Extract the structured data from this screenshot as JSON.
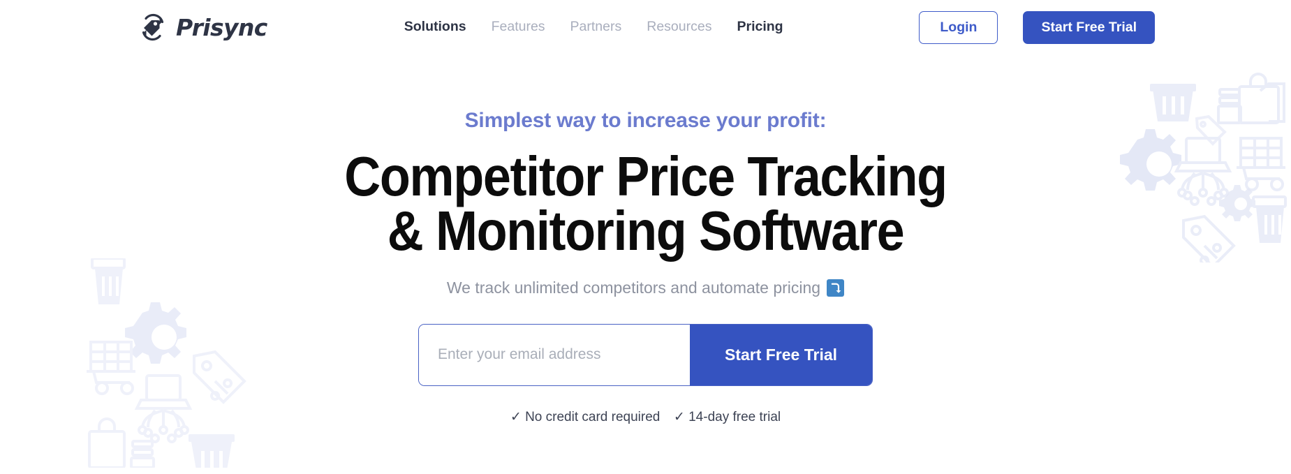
{
  "brand": {
    "name": "Prisync",
    "logo_icon": "price-tag-sync-icon",
    "logo_color": "#2E3445"
  },
  "colors": {
    "accent": "#3553C0",
    "login_border": "#3E5BC9",
    "eyebrow": "#6B7BCE",
    "nav_inactive": "#A9AEBD",
    "nav_active": "#2E3445",
    "headline": "#0C0C0C",
    "subhead": "#8D929F",
    "trust": "#3D4354",
    "decor": "#EAEDF8",
    "emoji_blue": "#3F86C6"
  },
  "header": {
    "nav": [
      {
        "label": "Solutions",
        "active": true
      },
      {
        "label": "Features",
        "active": false
      },
      {
        "label": "Partners",
        "active": false
      },
      {
        "label": "Resources",
        "active": false
      },
      {
        "label": "Pricing",
        "active": true
      }
    ],
    "login_label": "Login",
    "trial_label": "Start Free Trial"
  },
  "hero": {
    "eyebrow": "Simplest way to increase your profit:",
    "headline_line1": "Competitor Price Tracking",
    "headline_line2": "& Monitoring Software",
    "subhead": "We track unlimited competitors and automate pricing",
    "subhead_emoji": "right-arrow-curving-down-emoji",
    "email_placeholder": "Enter your email address",
    "email_value": "",
    "cta_label": "Start Free Trial",
    "trust_1": "✓ No credit card required",
    "trust_2": "✓ 14-day free trial"
  },
  "decorations": {
    "icons": [
      "shopping-basket-icon",
      "shopping-bag-icon",
      "gear-icon",
      "laptop-network-icon",
      "shopping-cart-icon",
      "price-tag-percent-icon",
      "trash-bin-icon"
    ]
  }
}
